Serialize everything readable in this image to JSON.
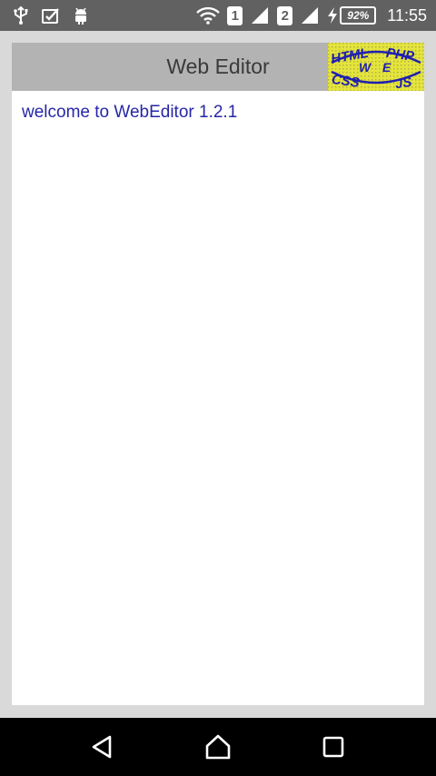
{
  "status_bar": {
    "sim1": "1",
    "sim2": "2",
    "battery": "92%",
    "time": "11:55",
    "icons": [
      "usb-icon",
      "clipboard-check-icon",
      "android-debug-icon",
      "wifi-icon",
      "signal-icon",
      "charging-icon"
    ]
  },
  "app": {
    "title": "Web Editor",
    "logo_text": {
      "html": "HTML",
      "php": "PHP",
      "w": "W",
      "e": "E",
      "css": "CSS",
      "js": "JS"
    },
    "welcome": "welcome to WebEditor 1.2.1"
  },
  "colors": {
    "status_bar": "#616161",
    "title_bar": "#b3b3b3",
    "welcome_text": "#2626a8",
    "logo_bg": "#e4e43c",
    "logo_text": "#1f1fb0"
  },
  "nav": {
    "buttons": [
      "back-icon",
      "home-icon",
      "recents-icon"
    ]
  }
}
